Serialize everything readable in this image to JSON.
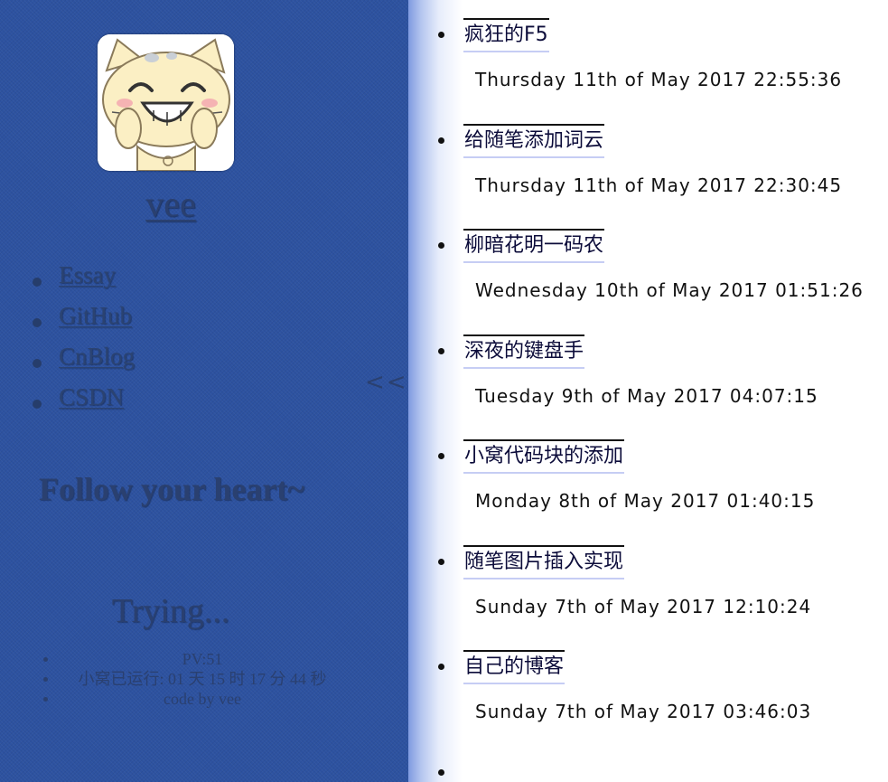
{
  "sidebar": {
    "site_name": "vee",
    "nav": [
      "Essay",
      "GitHub",
      "CnBlog",
      "CSDN"
    ],
    "toggle": "<<",
    "motto": "Follow your heart~",
    "status": "Trying...",
    "footer": [
      "PV:51",
      "小窝已运行: 01 天 15 时 17 分 44 秒",
      "code by vee"
    ]
  },
  "posts": [
    {
      "title": "疯狂的F5",
      "date": "Thursday 11th of May 2017 22:55:36"
    },
    {
      "title": "给随笔添加词云",
      "date": "Thursday 11th of May 2017 22:30:45"
    },
    {
      "title": "柳暗花明一码农",
      "date": "Wednesday 10th of May 2017 01:51:26"
    },
    {
      "title": "深夜的键盘手",
      "date": "Tuesday 9th of May 2017 04:07:15"
    },
    {
      "title": "小窝代码块的添加",
      "date": "Monday 8th of May 2017 01:40:15"
    },
    {
      "title": "随笔图片插入实现",
      "date": "Sunday 7th of May 2017 12:10:24"
    },
    {
      "title": "自己的博客",
      "date": "Sunday 7th of May 2017 03:46:03"
    }
  ],
  "colors": {
    "sidebar_bg": "#2d52a0",
    "sidebar_text": "#2a4070",
    "title_underline": "#c6cdf4"
  }
}
